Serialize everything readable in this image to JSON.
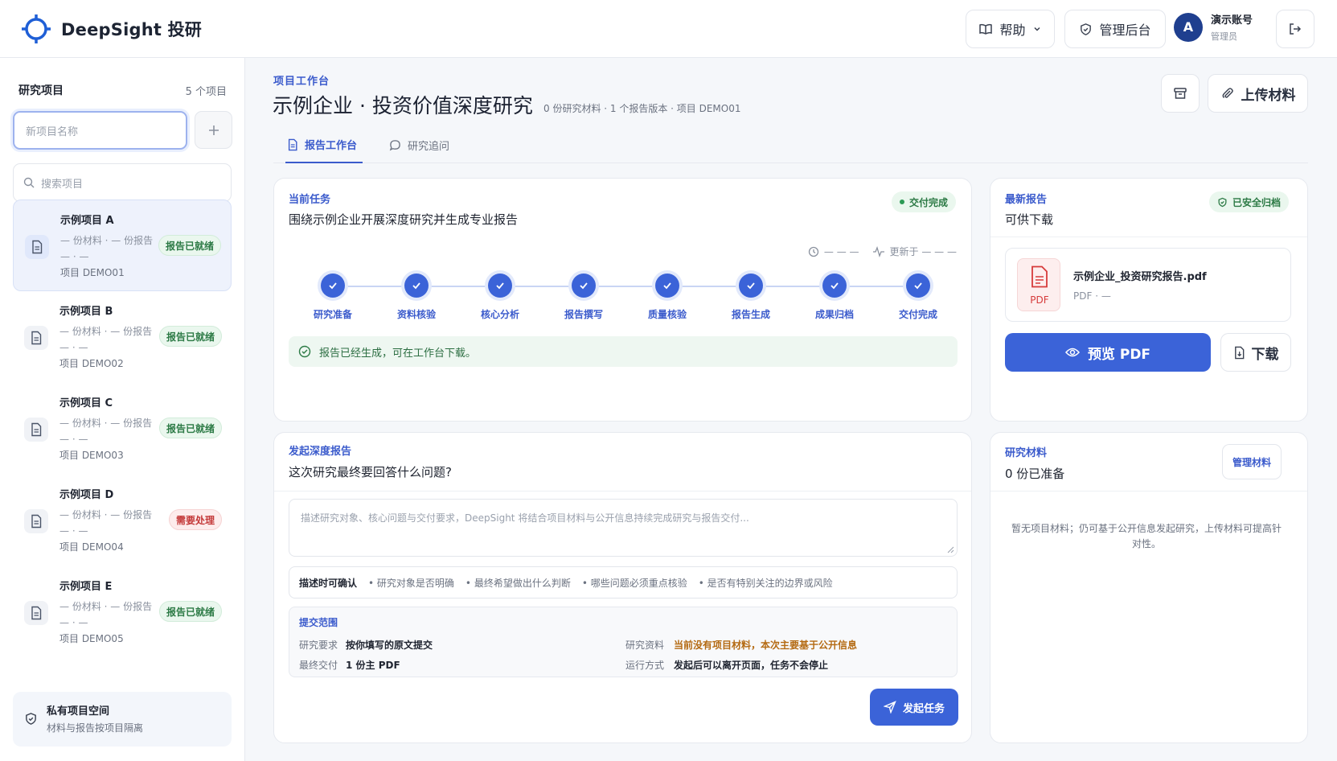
{
  "app": {
    "name": "DeepSight 投研"
  },
  "header": {
    "help_label": "帮助",
    "admin_label": "管理后台",
    "user": {
      "initial": "A",
      "name": "演示账号",
      "role": "管理员"
    }
  },
  "sidebar": {
    "title": "研究项目",
    "count": "5 个项目",
    "new_placeholder": "新项目名称",
    "search_placeholder": "搜索项目",
    "projects": [
      {
        "name": "示例项目 A",
        "meta": "— 份材料 · — 份报告 — · —",
        "code": "项目 DEMO01",
        "badge": "报告已就绪"
      },
      {
        "name": "示例项目 B",
        "meta": "— 份材料 · — 份报告 — · —",
        "code": "项目 DEMO02",
        "badge": "报告已就绪"
      },
      {
        "name": "示例项目 C",
        "meta": "— 份材料 · — 份报告 — · —",
        "code": "项目 DEMO03",
        "badge": "报告已就绪"
      },
      {
        "name": "示例项目 D",
        "meta": "— 份材料 · — 份报告 — · —",
        "code": "项目 DEMO04",
        "badge": "需要处理"
      },
      {
        "name": "示例项目 E",
        "meta": "— 份材料 · — 份报告 — · —",
        "code": "项目 DEMO05",
        "badge": "报告已就绪"
      }
    ],
    "footer": {
      "title": "私有项目空间",
      "subtitle": "材料与报告按项目隔离"
    }
  },
  "main": {
    "crumb": "项目工作台",
    "title": "示例企业 · 投资价值深度研究",
    "info": "0 份研究材料 · 1 个报告版本 · 项目 DEMO01",
    "upload_label": "上传材料",
    "tabs": [
      {
        "label": "报告工作台"
      },
      {
        "label": "研究追问"
      }
    ]
  },
  "task": {
    "tag": "当前任务",
    "title": "围绕示例企业开展深度研究并生成专业报告",
    "status": "交付完成",
    "time": "— — —",
    "updated": "更新于 — — —",
    "steps": [
      "研究准备",
      "资料核验",
      "核心分析",
      "报告撰写",
      "质量核验",
      "报告生成",
      "成果归档",
      "交付完成"
    ],
    "notice": "报告已经生成，可在工作台下载。"
  },
  "report": {
    "tag": "最新报告",
    "title": "可供下载",
    "archived": "已安全归档",
    "file_name": "示例企业_投资研究报告.pdf",
    "file_meta": "PDF · —",
    "file_type": "PDF",
    "preview_label": "预览 PDF",
    "download_label": "下载"
  },
  "launch": {
    "tag": "发起深度报告",
    "title": "这次研究最终要回答什么问题?",
    "placeholder": "描述研究对象、核心问题与交付要求，DeepSight 将结合项目材料与公开信息持续完成研究与报告交付...",
    "hint_label": "描述时可确认",
    "hints": [
      "• 研究对象是否明确",
      "• 最终希望做出什么判断",
      "• 哪些问题必须重点核验",
      "• 是否有特别关注的边界或风险"
    ],
    "scope": {
      "title": "提交范围",
      "req_k": "研究要求",
      "req_v": "按你填写的原文提交",
      "deliv_k": "最终交付",
      "deliv_v": "1 份主 PDF",
      "mat_k": "研究资料",
      "mat_v": "当前没有项目材料，本次主要基于公开信息",
      "run_k": "运行方式",
      "run_v": "发起后可以离开页面，任务不会停止"
    },
    "submit_label": "发起任务"
  },
  "materials": {
    "tag": "研究材料",
    "title": "0 份已准备",
    "manage_label": "管理材料",
    "empty_text": "暂无项目材料；仍可基于公开信息发起研究，上传材料可提高针对性。"
  }
}
